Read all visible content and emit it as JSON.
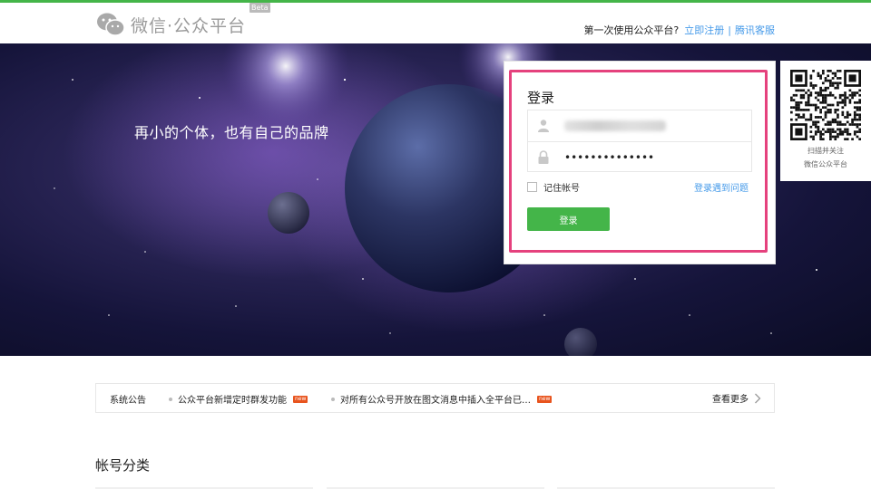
{
  "header": {
    "logo_text": "微信·公众平台",
    "beta_label": "Beta",
    "first_time_text": "第一次使用公众平台?",
    "register_link": "立即注册",
    "separator": "|",
    "support_link": "腾讯客服"
  },
  "banner": {
    "slogan": "再小的个体，也有自己的品牌"
  },
  "login": {
    "title": "登录",
    "password_value": "••••••••••••••",
    "remember_label": "记住帐号",
    "trouble_link": "登录遇到问题",
    "submit_label": "登录",
    "user_icon": "user-icon",
    "lock_icon": "lock-icon"
  },
  "qr": {
    "line1": "扫描并关注",
    "line2": "微信公众平台"
  },
  "notice": {
    "label": "系统公告",
    "items": [
      {
        "text": "公众平台新增定时群发功能",
        "badge": "new"
      },
      {
        "text": "对所有公众号开放在图文消息中插入全平台已…",
        "badge": "new"
      }
    ],
    "more": "查看更多"
  },
  "section": {
    "title": "帐号分类"
  },
  "colors": {
    "brand_green": "#44b549",
    "link_blue": "#459ae9",
    "highlight_pink": "#e5417d"
  }
}
